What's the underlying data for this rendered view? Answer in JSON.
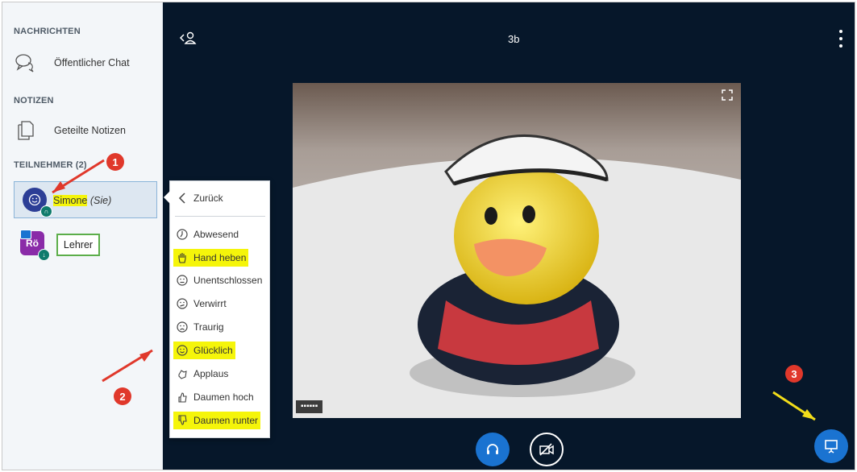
{
  "sidebar": {
    "messages_title": "NACHRICHTEN",
    "public_chat": "Öffentlicher Chat",
    "notes_title": "NOTIZEN",
    "shared_notes": "Geteilte Notizen",
    "participants_title": "TEILNEHMER (2)",
    "participants": [
      {
        "name": "Simone",
        "suffix": "(Sie)",
        "avatar_color": "#2c3e96"
      },
      {
        "initials": "Rö",
        "label": "Lehrer",
        "avatar_color": "#8a2ba8"
      }
    ]
  },
  "header": {
    "room_title": "3b"
  },
  "video": {
    "user_name": "▪▪▪▪▪▪"
  },
  "status_menu": {
    "back": "Zurück",
    "items": [
      {
        "label": "Abwesend",
        "icon": "clock-icon"
      },
      {
        "label": "Hand heben",
        "icon": "raise-hand-icon",
        "highlight": true
      },
      {
        "label": "Unentschlossen",
        "icon": "neutral-face-icon"
      },
      {
        "label": "Verwirrt",
        "icon": "confused-face-icon"
      },
      {
        "label": "Traurig",
        "icon": "sad-face-icon"
      },
      {
        "label": "Glücklich",
        "icon": "happy-face-icon",
        "highlight": true
      },
      {
        "label": "Applaus",
        "icon": "applause-icon"
      },
      {
        "label": "Daumen hoch",
        "icon": "thumbs-up-icon"
      },
      {
        "label": "Daumen runter",
        "icon": "thumbs-down-icon",
        "highlight": true
      }
    ]
  },
  "callouts": [
    "1",
    "2",
    "3"
  ],
  "colors": {
    "main_bg": "#06172a",
    "primary_blue": "#1a73d1",
    "highlight_yellow": "#f5f50a",
    "callout_red": "#e0382b",
    "teacher_green": "#5cae4a"
  }
}
